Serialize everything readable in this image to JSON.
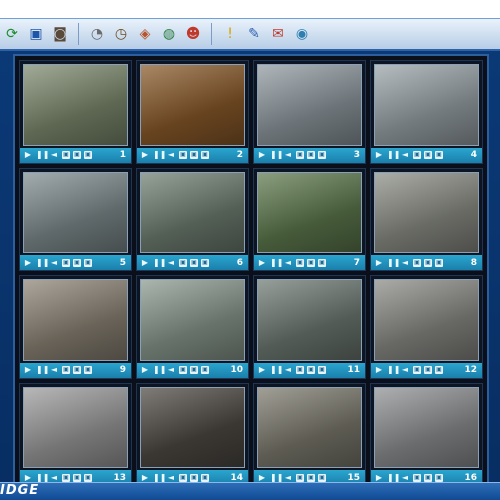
{
  "toolbar": {
    "icons": [
      {
        "name": "connect-icon",
        "glyph": "⟳",
        "color": "#1c8c2e"
      },
      {
        "name": "save-icon",
        "glyph": "▣",
        "color": "#1f55a8"
      },
      {
        "name": "snapshot-icon",
        "glyph": "◙",
        "color": "#5a4a3a"
      },
      {
        "name": "record-icon",
        "glyph": "◔",
        "color": "#6b6b6b"
      },
      {
        "name": "clock-icon",
        "glyph": "◷",
        "color": "#6b4a1e"
      },
      {
        "name": "playback-icon",
        "glyph": "◈",
        "color": "#b5562c"
      },
      {
        "name": "globe-icon",
        "glyph": "◍",
        "color": "#2a7d3e"
      },
      {
        "name": "users-icon",
        "glyph": "☻",
        "color": "#c0392b"
      },
      {
        "name": "alarm-icon",
        "glyph": "!",
        "color": "#d9a400"
      },
      {
        "name": "tools-icon",
        "glyph": "✎",
        "color": "#2e5fb0"
      },
      {
        "name": "message-icon",
        "glyph": "✉",
        "color": "#c0392b"
      },
      {
        "name": "help-icon",
        "glyph": "◉",
        "color": "#2e7fb0"
      }
    ]
  },
  "channels": [
    {
      "number": "1",
      "bg": "#7d8a6e"
    },
    {
      "number": "2",
      "bg": "#8a5a2a"
    },
    {
      "number": "3",
      "bg": "#8f9aa0"
    },
    {
      "number": "4",
      "bg": "#9aa4a8"
    },
    {
      "number": "5",
      "bg": "#7f8c8e"
    },
    {
      "number": "6",
      "bg": "#6f7e72"
    },
    {
      "number": "7",
      "bg": "#5e7a4e"
    },
    {
      "number": "8",
      "bg": "#8c8e86"
    },
    {
      "number": "9",
      "bg": "#8c8476"
    },
    {
      "number": "10",
      "bg": "#8a9a8e"
    },
    {
      "number": "11",
      "bg": "#6e7a72"
    },
    {
      "number": "12",
      "bg": "#8a8a86"
    },
    {
      "number": "13",
      "bg": "#9c9c9c"
    },
    {
      "number": "14",
      "bg": "#4e4a44"
    },
    {
      "number": "15",
      "bg": "#7c7a6e"
    },
    {
      "number": "16",
      "bg": "#8e9092"
    }
  ],
  "control_icons": [
    "▶",
    "❚❚",
    "◄",
    "▣",
    "▣",
    "▣"
  ],
  "status": {
    "brand": "IDGE"
  }
}
